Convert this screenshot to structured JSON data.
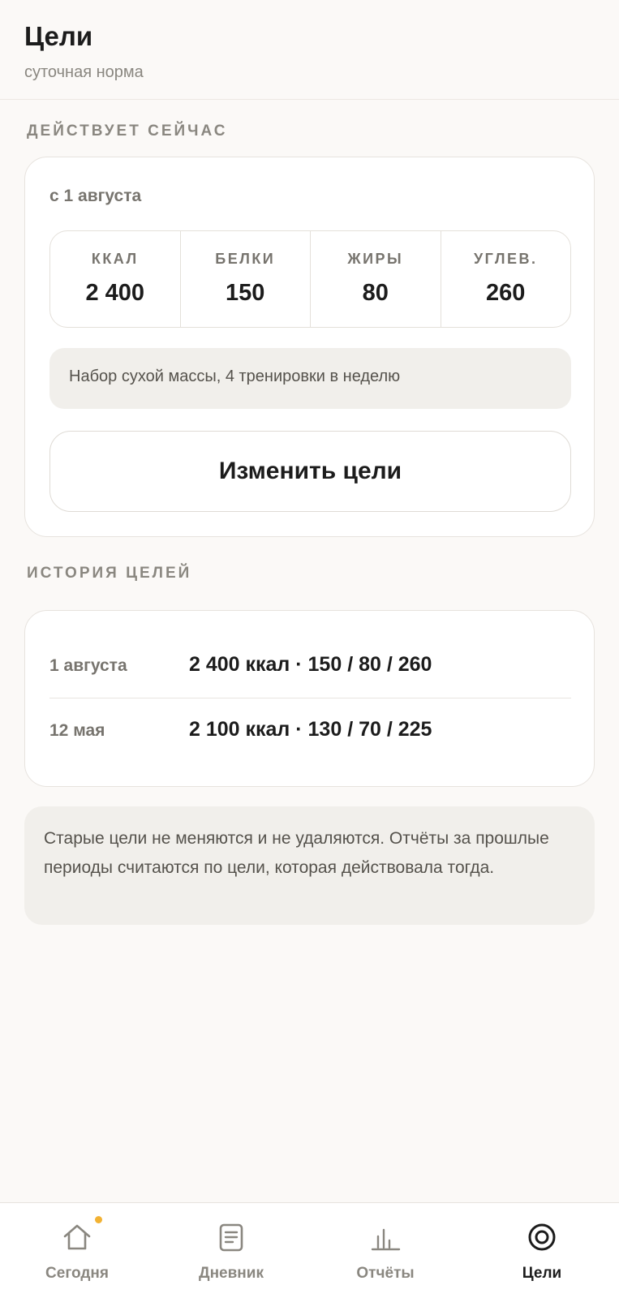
{
  "header": {
    "title": "Цели",
    "subtitle": "суточная норма"
  },
  "current": {
    "section_label": "ДЕЙСТВУЕТ СЕЙЧАС",
    "since": "с 1 августа",
    "macros": [
      {
        "label": "ККАЛ",
        "value": "2 400"
      },
      {
        "label": "БЕЛКИ",
        "value": "150"
      },
      {
        "label": "ЖИРЫ",
        "value": "80"
      },
      {
        "label": "УГЛЕВ.",
        "value": "260"
      }
    ],
    "note": "Набор сухой массы, 4 тренировки в неделю",
    "edit_button": "Изменить цели"
  },
  "history": {
    "section_label": "ИСТОРИЯ ЦЕЛЕЙ",
    "rows": [
      {
        "date": "1 августа",
        "value": "2 400 ккал · 150 / 80 / 260"
      },
      {
        "date": "12 мая",
        "value": "2 100 ккал · 130 / 70 / 225"
      }
    ]
  },
  "info": "Старые цели не меняются и не удаляются. Отчёты за прошлые периоды считаются по цели, которая действовала тогда.",
  "nav": {
    "items": [
      {
        "label": "Сегодня",
        "icon": "home-icon",
        "badge": true
      },
      {
        "label": "Дневник",
        "icon": "diary-icon"
      },
      {
        "label": "Отчёты",
        "icon": "reports-icon"
      },
      {
        "label": "Цели",
        "icon": "goals-icon",
        "active": true
      }
    ]
  },
  "colors": {
    "background": "#FBF9F7",
    "card": "#FFFFFF",
    "muted_box": "#F1EFEB",
    "badge": "#F2B233",
    "text_primary": "#1C1C1C",
    "text_muted": "#8A8780"
  }
}
